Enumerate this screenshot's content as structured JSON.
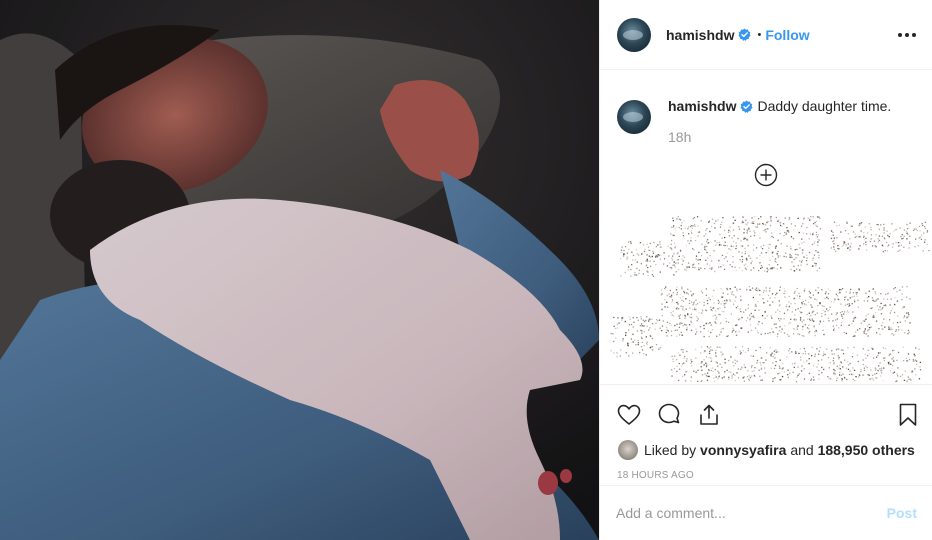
{
  "header": {
    "username": "hamishdw",
    "separator": "•",
    "follow_label": "Follow"
  },
  "caption": {
    "username": "hamishdw",
    "text": "Daddy daughter time.",
    "time_ago": "18h"
  },
  "actions": {
    "liked_by_prefix": "Liked by",
    "liked_by_user": "vonnysyafira",
    "liked_by_mid": "and",
    "others_count": "188,950 others"
  },
  "timestamp": "18 HOURS AGO",
  "comment": {
    "placeholder": "Add a comment...",
    "post_label": "Post"
  },
  "colors": {
    "link_blue": "#3897f0",
    "verified_blue": "#3897f0",
    "post_disabled": "#b2dffc",
    "muted": "#999999"
  },
  "icons": [
    "verified-icon",
    "more-options-icon",
    "load-more-comments-icon",
    "heart-icon",
    "comment-icon",
    "share-icon",
    "bookmark-icon"
  ]
}
